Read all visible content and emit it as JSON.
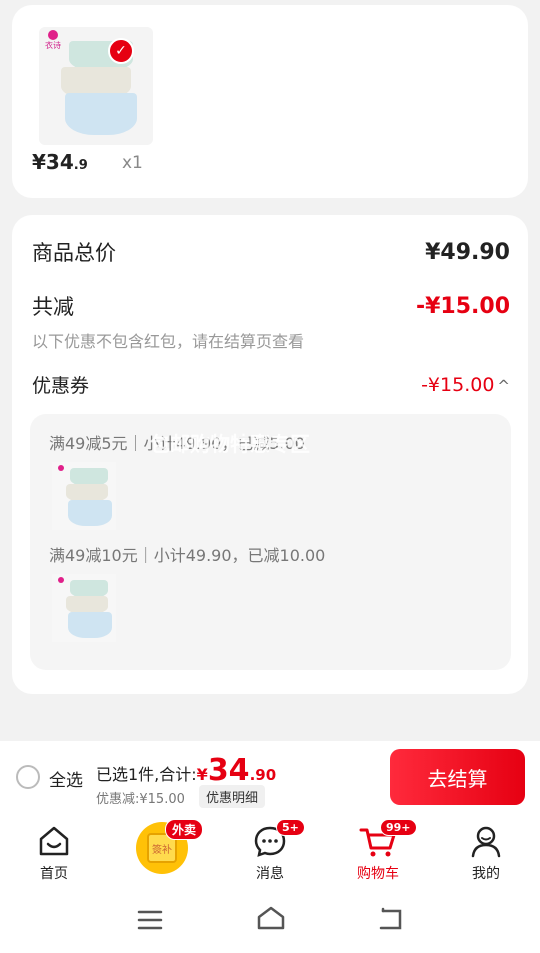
{
  "product": {
    "brand_mini": "衣诗",
    "price_int": "¥34",
    "price_dec": ".9",
    "quantity": "x1"
  },
  "summary": {
    "total_label": "商品总价",
    "total_value": "¥49.90",
    "discount_label": "共减",
    "discount_value": "-¥15.00",
    "note": "以下优惠不包含红包，请在结算页查看",
    "coupon_label": "优惠券",
    "coupon_value": "-¥15.00",
    "coupon_chevron": "^"
  },
  "coupons": [
    {
      "text": "满49减5元｜小计49.90，已减5.00",
      "brand_mini": "衣诗"
    },
    {
      "text": "满49减10元｜小计49.90，已减10.00",
      "brand_mini": "衣诗"
    }
  ],
  "overlay_text": "包邮购物特惠专区",
  "checkout": {
    "select_all": "全选",
    "selected_prefix": "已选1件,合计:",
    "yen": "¥",
    "amount_int": "34",
    "amount_dec": ".90",
    "discount_text": "优惠减:¥15.00",
    "detail_button": "优惠明细",
    "pay_button": "去结算"
  },
  "tabs": [
    {
      "label": "首页",
      "icon": "home-icon"
    },
    {
      "label": "外卖",
      "icon": "takeout-icon",
      "badge": "外卖",
      "inner": "簽补"
    },
    {
      "label": "消息",
      "icon": "message-icon",
      "badge": "5+"
    },
    {
      "label": "购物车",
      "icon": "cart-icon",
      "badge": "99+"
    },
    {
      "label": "我的",
      "icon": "profile-icon"
    }
  ],
  "colors": {
    "accent": "#e60012",
    "background": "#f2f2f2"
  }
}
